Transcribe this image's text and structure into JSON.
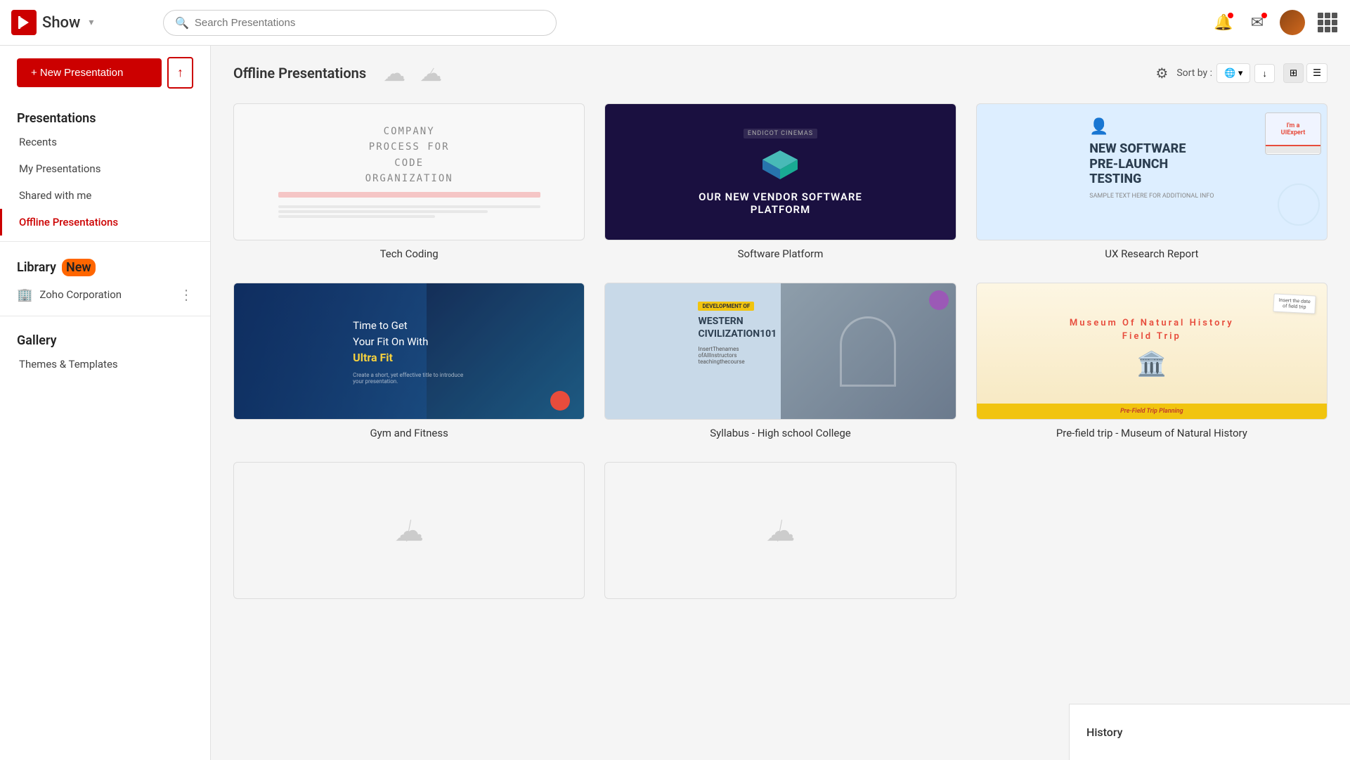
{
  "app": {
    "name": "Show",
    "logo_label": "Show"
  },
  "header": {
    "search_placeholder": "Search Presentations",
    "sort_label": "Sort by :",
    "settings_label": "⚙"
  },
  "sidebar": {
    "new_button": "+ New Presentation",
    "upload_icon": "↑",
    "presentations_heading": "Presentations",
    "nav_items": [
      {
        "id": "recents",
        "label": "Recents"
      },
      {
        "id": "my-presentations",
        "label": "My Presentations"
      },
      {
        "id": "shared",
        "label": "Shared with me"
      },
      {
        "id": "offline",
        "label": "Offline Presentations"
      }
    ],
    "library_heading": "Library",
    "library_badge": "New",
    "library_items": [
      {
        "id": "zoho-corp",
        "label": "Zoho Corporation"
      }
    ],
    "gallery_heading": "Gallery",
    "gallery_items": [
      {
        "id": "themes",
        "label": "Themes & Templates"
      }
    ]
  },
  "content": {
    "section_title": "Offline Presentations",
    "presentations": [
      {
        "id": "tech-coding",
        "name": "Tech Coding",
        "type": "tech",
        "title_lines": [
          "COMPANY",
          "PROCESS FOR",
          "CODE",
          "ORGANIZATION"
        ]
      },
      {
        "id": "software-platform",
        "name": "Software Platform",
        "type": "software",
        "badge": "ENDICOT CINEMAS",
        "title": "OUR NEW VENDOR SOFTWARE PLATFORM"
      },
      {
        "id": "ux-research",
        "name": "UX Research Report",
        "type": "ux",
        "title": "NEW SOFTWARE PRE-LAUNCH TESTING"
      },
      {
        "id": "gym-fitness",
        "name": "Gym and Fitness",
        "type": "gym",
        "line1": "Time to Get",
        "line2": "Your Fit On With",
        "highlight": "Ultra Fit",
        "sub": "Create a short, yet effective title to introduce your presentation."
      },
      {
        "id": "syllabus",
        "name": "Syllabus - High school College",
        "type": "syllabus",
        "badge": "DEVELOPMENT OF",
        "title": "WESTERN CIVILIZATION101"
      },
      {
        "id": "museum",
        "name": "Pre-field trip - Museum of Natural History",
        "type": "museum",
        "title_line1": "Museum   Of  Natural  History",
        "title_line2": "Field  Trip",
        "bar_text": "Pre-Field Trip Planning",
        "note": "Insert the date of field trip"
      }
    ]
  },
  "history": {
    "label": "History"
  }
}
